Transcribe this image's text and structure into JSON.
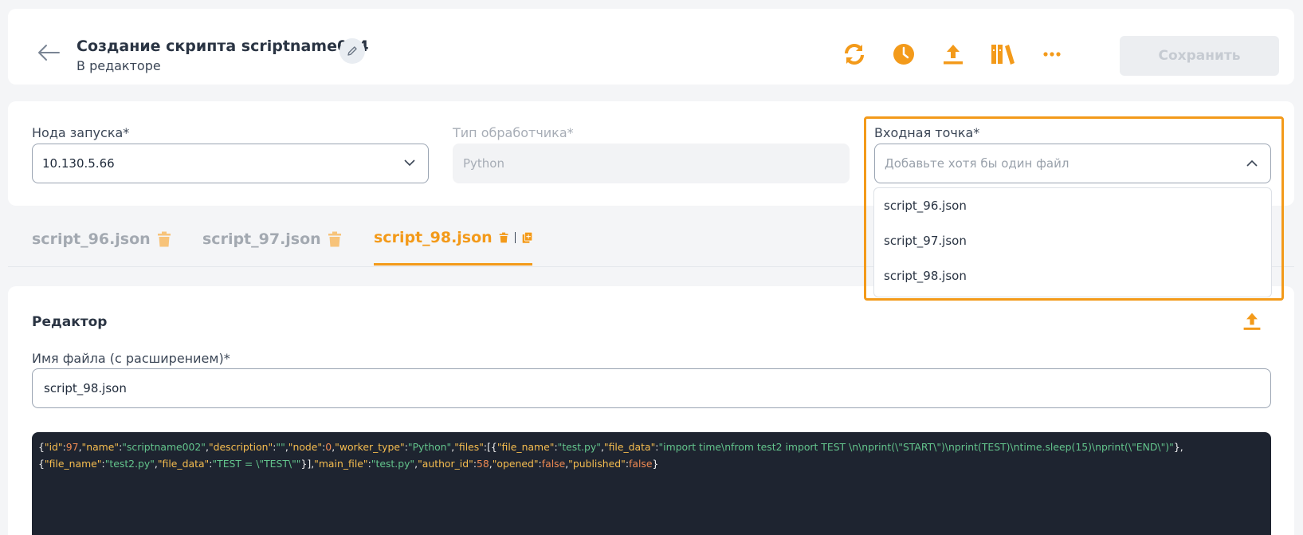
{
  "header": {
    "title": "Создание скрипта scriptname004",
    "subtitle": "В редакторе",
    "save_label": "Сохранить",
    "tools": [
      "refresh-icon",
      "history-icon",
      "upload-icon",
      "library-icon",
      "more-icon"
    ]
  },
  "form": {
    "node_label": "Нода запуска*",
    "node_value": "10.130.5.66",
    "handler_label": "Тип обработчика*",
    "handler_value": "Python",
    "entry_label": "Входная точка*",
    "entry_placeholder": "Добавьте хотя бы один файл",
    "entry_options": [
      "script_96.json",
      "script_97.json",
      "script_98.json"
    ]
  },
  "tabs": [
    {
      "label": "script_96.json",
      "active": false
    },
    {
      "label": "script_97.json",
      "active": false
    },
    {
      "label": "script_98.json",
      "active": true
    }
  ],
  "editor": {
    "title": "Редактор",
    "filename_label": "Имя файла (с расширением)*",
    "filename_value": "script_98.json",
    "code_tokens": [
      [
        "p",
        "{"
      ],
      [
        "k",
        "\"id\""
      ],
      [
        "p",
        ":"
      ],
      [
        "n",
        "97"
      ],
      [
        "p",
        ","
      ],
      [
        "k",
        "\"name\""
      ],
      [
        "p",
        ":"
      ],
      [
        "s",
        "\"scriptname002\""
      ],
      [
        "p",
        ","
      ],
      [
        "k",
        "\"description\""
      ],
      [
        "p",
        ":"
      ],
      [
        "s",
        "\"\""
      ],
      [
        "p",
        ","
      ],
      [
        "k",
        "\"node\""
      ],
      [
        "p",
        ":"
      ],
      [
        "n",
        "0"
      ],
      [
        "p",
        ","
      ],
      [
        "k",
        "\"worker_type\""
      ],
      [
        "p",
        ":"
      ],
      [
        "s",
        "\"Python\""
      ],
      [
        "p",
        ","
      ],
      [
        "k",
        "\"files\""
      ],
      [
        "p",
        ":[{"
      ],
      [
        "k",
        "\"file_name\""
      ],
      [
        "p",
        ":"
      ],
      [
        "s",
        "\"test.py\""
      ],
      [
        "p",
        ","
      ],
      [
        "k",
        "\"file_data\""
      ],
      [
        "p",
        ":"
      ],
      [
        "s",
        "\"import time\\nfrom test2 import TEST \\n\\nprint(\\\"START\\\")\\nprint(TEST)\\ntime.sleep(15)\\nprint(\\\"END\\\")\""
      ],
      [
        "p",
        "},\n{"
      ],
      [
        "k",
        "\"file_name\""
      ],
      [
        "p",
        ":"
      ],
      [
        "s",
        "\"test2.py\""
      ],
      [
        "p",
        ","
      ],
      [
        "k",
        "\"file_data\""
      ],
      [
        "p",
        ":"
      ],
      [
        "s",
        "\"TEST = \\\"TEST\\\"\""
      ],
      [
        "p",
        "}],"
      ],
      [
        "k",
        "\"main_file\""
      ],
      [
        "p",
        ":"
      ],
      [
        "s",
        "\"test.py\""
      ],
      [
        "p",
        ","
      ],
      [
        "k",
        "\"author_id\""
      ],
      [
        "p",
        ":"
      ],
      [
        "n",
        "58"
      ],
      [
        "p",
        ","
      ],
      [
        "k",
        "\"opened\""
      ],
      [
        "p",
        ":"
      ],
      [
        "n",
        "false"
      ],
      [
        "p",
        ","
      ],
      [
        "k",
        "\"published\""
      ],
      [
        "p",
        ":"
      ],
      [
        "n",
        "false"
      ],
      [
        "p",
        "}"
      ]
    ]
  },
  "colors": {
    "accent": "#f39a1a",
    "code_bg": "#1e2430",
    "code_key": "#f6bd4f",
    "code_string": "#63c48c",
    "code_number": "#f08a52"
  }
}
